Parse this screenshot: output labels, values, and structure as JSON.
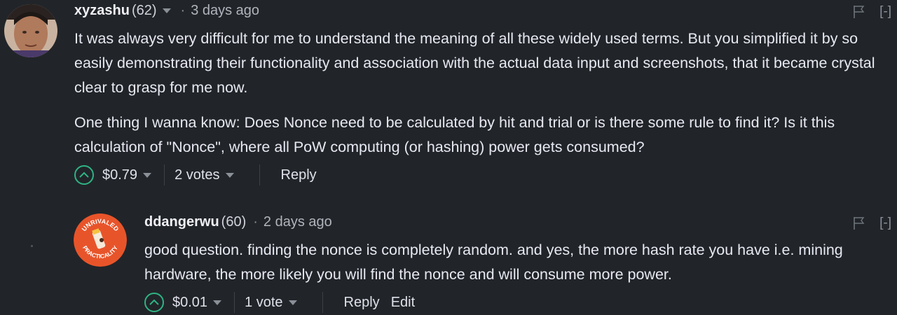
{
  "comments": [
    {
      "author": "xyzashu",
      "reputation": "(62)",
      "separator": "·",
      "time": "3 days ago",
      "collapse_label": "[-]",
      "paragraphs": [
        "It was always very difficult for me to understand the meaning of all these widely used terms. But you simplified it by so easily demonstrating their functionality and association with the actual data input and screenshots, that it became crystal clear to grasp for me now.",
        "One thing I wanna know: Does Nonce need to be calculated by hit and trial or is there some rule to find it? Is it this calculation of \"Nonce\", where all PoW computing (or hashing) power gets consumed?"
      ],
      "payout": "$0.79",
      "votes": "2 votes",
      "reply_label": "Reply"
    },
    {
      "author": "ddangerwu",
      "reputation": "(60)",
      "separator": "·",
      "time": "2 days ago",
      "collapse_label": "[-]",
      "paragraphs": [
        "good question. finding the nonce is completely random. and yes, the more hash rate you have i.e. mining hardware, the more likely you will find the nonce and will consume more power."
      ],
      "payout": "$0.01",
      "votes": "1 vote",
      "reply_label": "Reply",
      "edit_label": "Edit",
      "avatar_text_top": "UNRIVALED",
      "avatar_text_bottom": "PRACTICALITY"
    }
  ],
  "colors": {
    "background": "#212529",
    "upvote_accent": "#2fb383",
    "avatar2_bg": "#e8542a"
  },
  "icons": [
    "flag-icon",
    "chevron-up-icon",
    "caret-down-icon"
  ]
}
